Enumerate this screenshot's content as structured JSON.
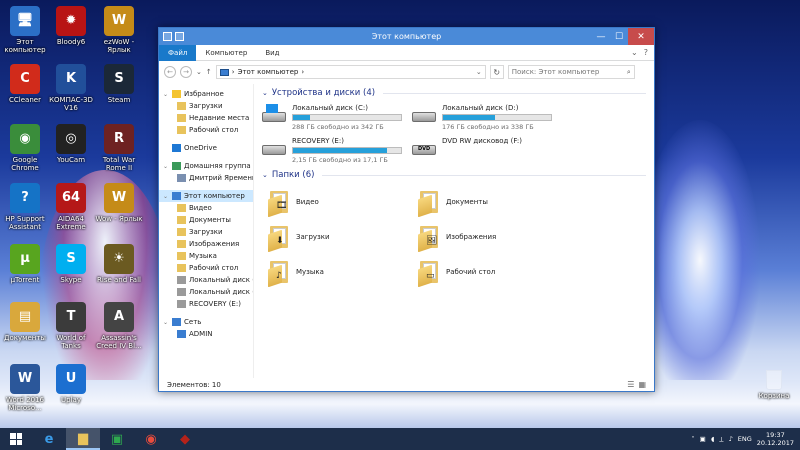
{
  "desktop": {
    "icons": [
      {
        "label": "Этот компьютер",
        "glyph": "🖥",
        "bg": "#2b6fc6"
      },
      {
        "label": "Bloody6",
        "glyph": "✹",
        "bg": "#b81414"
      },
      {
        "label": "ezWoW - Ярлык",
        "glyph": "W",
        "bg": "#c58b18"
      },
      {
        "label": "CCleaner",
        "glyph": "C",
        "bg": "#d12b1b"
      },
      {
        "label": "КОМПАС-3D V16",
        "glyph": "K",
        "bg": "#214f9a"
      },
      {
        "label": "Steam",
        "glyph": "S",
        "bg": "#1b2838"
      },
      {
        "label": "Google Chrome",
        "glyph": "◉",
        "bg": "#3a8d3b"
      },
      {
        "label": "YouCam",
        "glyph": "◎",
        "bg": "#222222"
      },
      {
        "label": "Total War Rome II",
        "glyph": "R",
        "bg": "#6e2222"
      },
      {
        "label": "HP Support Assistant",
        "glyph": "?",
        "bg": "#1573c6"
      },
      {
        "label": "AIDA64 Extreme",
        "glyph": "64",
        "bg": "#b51818"
      },
      {
        "label": "Wow - Ярлык",
        "glyph": "W",
        "bg": "#c58b18"
      },
      {
        "label": "µTorrent",
        "glyph": "µ",
        "bg": "#58a51f"
      },
      {
        "label": "Skype",
        "glyph": "S",
        "bg": "#00aff0"
      },
      {
        "label": "Rise and Fall",
        "glyph": "☀",
        "bg": "#6b5a21"
      },
      {
        "label": "Документы",
        "glyph": "▤",
        "bg": "#d9a83c"
      },
      {
        "label": "World of Tanks",
        "glyph": "T",
        "bg": "#3b3b3b"
      },
      {
        "label": "Assassin's Creed IV Bl...",
        "glyph": "A",
        "bg": "#444444"
      },
      {
        "label": "Word 2016 Microso...",
        "glyph": "W",
        "bg": "#2b579a"
      },
      {
        "label": "Uplay",
        "glyph": "U",
        "bg": "#1c6fd0"
      }
    ],
    "recycle_bin": "Корзина"
  },
  "window": {
    "title": "Этот компьютер",
    "minimize": "—",
    "maximize": "☐",
    "close": "✕",
    "ribbon_tabs": [
      "Файл",
      "Компьютер",
      "Вид"
    ],
    "ribbon_right": [
      "⌄",
      "?"
    ],
    "nav": {
      "back": "←",
      "forward": "→",
      "recent": "⌄",
      "up": "↑",
      "address_root": "›",
      "address": "Этот компьютер",
      "address_sep": "›",
      "address_dropdown": "⌄",
      "refresh": "↻",
      "search_placeholder": "Поиск: Этот компьютер",
      "search_icon": "⌕"
    },
    "sidebar": {
      "favorites": {
        "label": "Избранное",
        "items": [
          "Загрузки",
          "Недавние места",
          "Рабочий стол"
        ]
      },
      "onedrive": "OneDrive",
      "homegroup": {
        "label": "Домашняя группа",
        "items": [
          "Дмитрий Яременко"
        ]
      },
      "this_pc": {
        "label": "Этот компьютер",
        "items": [
          "Видео",
          "Документы",
          "Загрузки",
          "Изображения",
          "Музыка",
          "Рабочий стол",
          "Локальный диск (С",
          "Локальный диск (D",
          "RECOVERY (E:)"
        ]
      },
      "network": {
        "label": "Сеть",
        "items": [
          "ADMIN"
        ]
      }
    },
    "devices_header": "Устройства и диски (4)",
    "drives": [
      {
        "name": "Локальный диск (C:)",
        "info": "288 ГБ свободно из 342 ГБ",
        "used_fraction": 0.16,
        "type": "system"
      },
      {
        "name": "Локальный диск (D:)",
        "info": "176 ГБ свободно из 338 ГБ",
        "used_fraction": 0.48,
        "type": "hdd"
      },
      {
        "name": "RECOVERY (E:)",
        "info": "2,15 ГБ свободно из 17,1 ГБ",
        "used_fraction": 0.87,
        "type": "hdd"
      },
      {
        "name": "DVD RW дисковод (F:)",
        "info": "",
        "used_fraction": null,
        "type": "dvd",
        "icon_label": "DVD"
      }
    ],
    "folders_header": "Папки (6)",
    "folders": [
      {
        "name": "Видео",
        "badge": "🎞"
      },
      {
        "name": "Документы",
        "badge": ""
      },
      {
        "name": "Загрузки",
        "badge": "⬇"
      },
      {
        "name": "Изображения",
        "badge": "🖼"
      },
      {
        "name": "Музыка",
        "badge": "♪"
      },
      {
        "name": "Рабочий стол",
        "badge": "▭"
      }
    ],
    "status": "Элементов: 10",
    "view_icons": [
      "☰",
      "▦"
    ]
  },
  "taskbar": {
    "apps": [
      {
        "name": "Internet Explorer",
        "glyph": "e",
        "color": "#3a9be8"
      },
      {
        "name": "File Explorer",
        "glyph": "▆",
        "color": "#e8c35c"
      },
      {
        "name": "Store",
        "glyph": "▣",
        "color": "#2fa84f"
      },
      {
        "name": "Chrome",
        "glyph": "◉",
        "color": "#e84c3d"
      },
      {
        "name": "Dota 2",
        "glyph": "◆",
        "color": "#b5221a"
      }
    ],
    "tray_up": "˄",
    "tray_icons": [
      "▣",
      "◖",
      "⟂",
      "♪"
    ],
    "language": "ENG",
    "time": "19:37",
    "date": "20.12.2017"
  }
}
